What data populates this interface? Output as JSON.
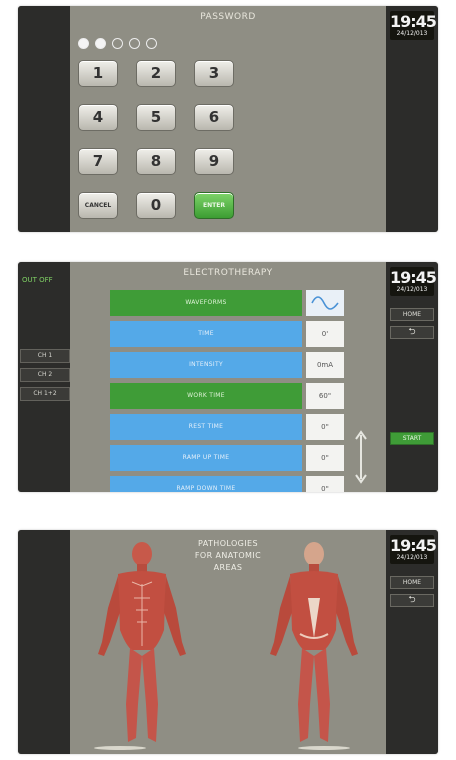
{
  "colors": {
    "panel_bg": "#8f8e84",
    "side_bar": "#2c2c2a",
    "accent_green": "#3f9c37",
    "accent_blue": "#54a9e8"
  },
  "password_screen": {
    "title": "PASSWORD",
    "clock": {
      "time": "19:45",
      "date": "24/12/013"
    },
    "entered_digits": 2,
    "total_digits": 5,
    "keys": [
      "1",
      "2",
      "3",
      "4",
      "5",
      "6",
      "7",
      "8",
      "9",
      "CANCEL",
      "0",
      "ENTER"
    ]
  },
  "electro_screen": {
    "title": "ELECTROTHERAPY",
    "status": "OUT OFF",
    "channels": [
      "CH 1",
      "CH 2",
      "CH 1+2"
    ],
    "clock": {
      "time": "19:45",
      "date": "24/12/013"
    },
    "home_label": "HOME",
    "back_icon": "back-arrow-icon",
    "start_label": "START",
    "rows": [
      {
        "label": "WAVEFORMS",
        "value": "",
        "color": "green",
        "icon": "sine-wave-icon"
      },
      {
        "label": "TIME",
        "value": "0'",
        "color": "blue"
      },
      {
        "label": "INTENSITY",
        "value": "0mA",
        "color": "blue"
      },
      {
        "label": "WORK TIME",
        "value": "60\"",
        "color": "green"
      },
      {
        "label": "REST TIME",
        "value": "0\"",
        "color": "blue"
      },
      {
        "label": "RAMP UP TIME",
        "value": "0\"",
        "color": "blue"
      },
      {
        "label": "RAMP DOWN TIME",
        "value": "0\"",
        "color": "blue"
      }
    ]
  },
  "pathology_screen": {
    "title_line1": "PATHOLOGIES",
    "title_line2": "FOR ANATOMIC",
    "title_line3": "AREAS",
    "clock": {
      "time": "19:45",
      "date": "24/12/013"
    },
    "home_label": "HOME",
    "back_icon": "back-arrow-icon"
  }
}
